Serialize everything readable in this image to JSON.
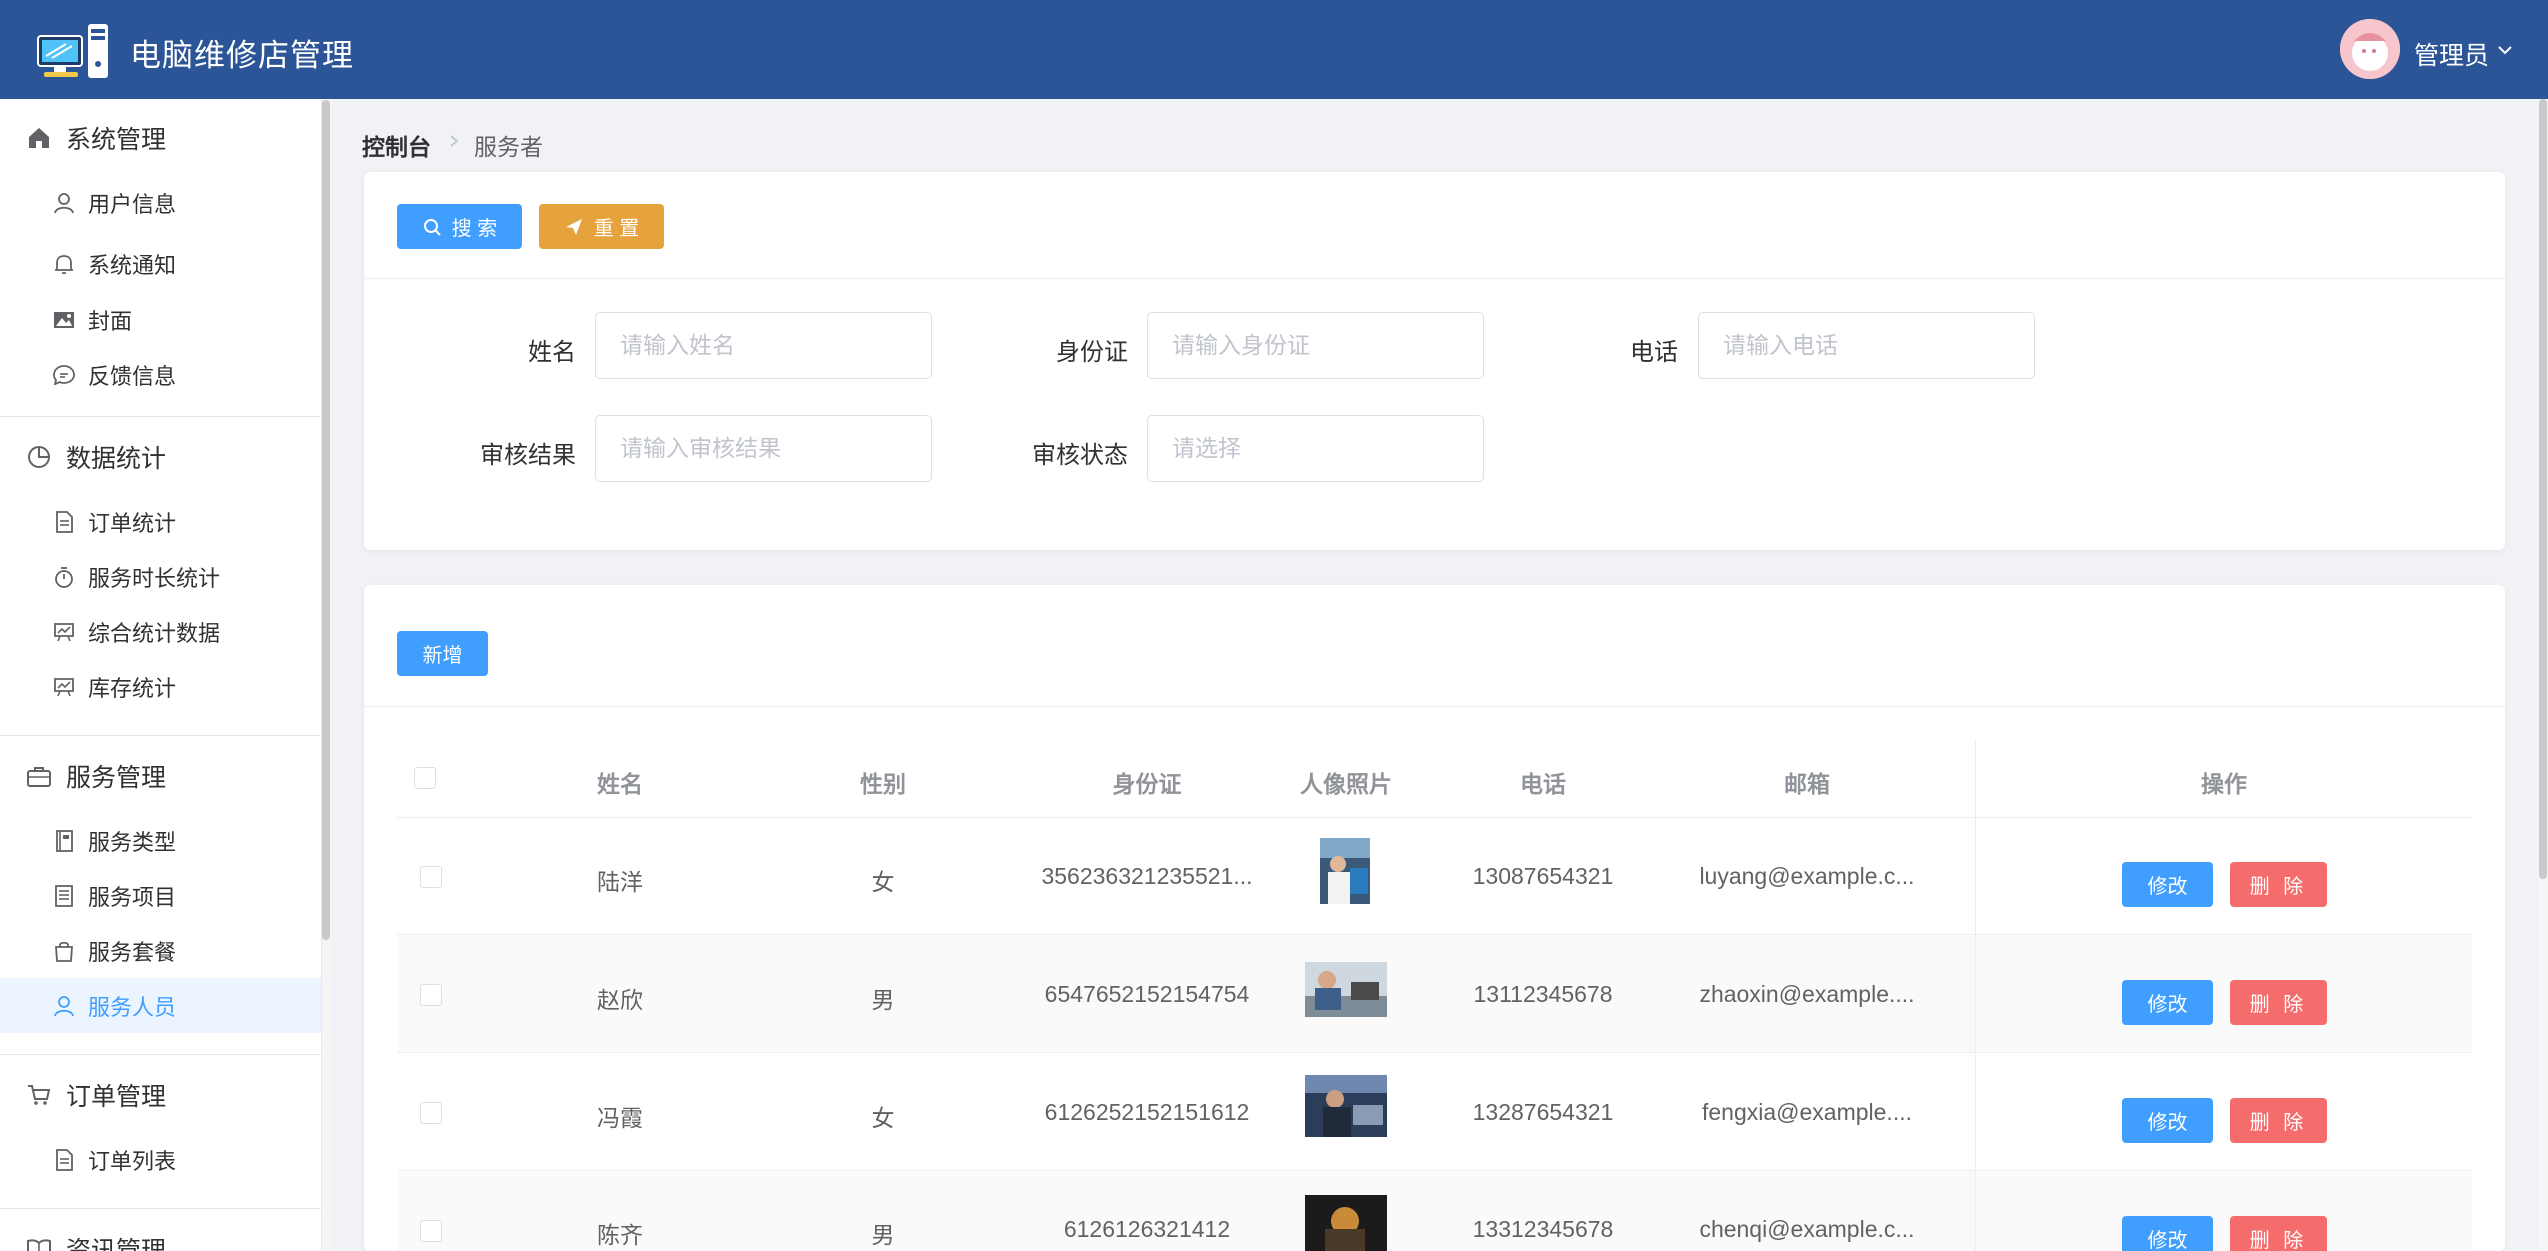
{
  "header": {
    "app_title": "电脑维修店管理",
    "user_name": "管理员",
    "bg_color": "#2b5597"
  },
  "sidebar": {
    "groups": [
      {
        "label": "系统管理",
        "icon": "home-icon",
        "items": [
          {
            "label": "用户信息",
            "icon": "user-icon"
          },
          {
            "label": "系统通知",
            "icon": "bell-icon"
          },
          {
            "label": "封面",
            "icon": "picture-icon"
          },
          {
            "label": "反馈信息",
            "icon": "chat-icon"
          }
        ]
      },
      {
        "label": "数据统计",
        "icon": "pie-chart-icon",
        "items": [
          {
            "label": "订单统计",
            "icon": "document-icon"
          },
          {
            "label": "服务时长统计",
            "icon": "stopwatch-icon"
          },
          {
            "label": "综合统计数据",
            "icon": "data-board-icon"
          },
          {
            "label": "库存统计",
            "icon": "data-board-icon"
          }
        ]
      },
      {
        "label": "服务管理",
        "icon": "briefcase-icon",
        "items": [
          {
            "label": "服务类型",
            "icon": "notebook-icon"
          },
          {
            "label": "服务项目",
            "icon": "list-icon"
          },
          {
            "label": "服务套餐",
            "icon": "bag-icon"
          },
          {
            "label": "服务人员",
            "icon": "user-icon",
            "active": true
          }
        ]
      },
      {
        "label": "订单管理",
        "icon": "cart-icon",
        "items": [
          {
            "label": "订单列表",
            "icon": "document-icon"
          }
        ]
      },
      {
        "label": "资讯管理",
        "icon": "reading-icon",
        "items": []
      }
    ]
  },
  "breadcrumb": {
    "home": "控制台",
    "current": "服务者"
  },
  "toolbar": {
    "search_label": "搜 索",
    "reset_label": "重 置",
    "add_label": "新增"
  },
  "filters": {
    "name": {
      "label": "姓名",
      "placeholder": "请输入姓名"
    },
    "id_card": {
      "label": "身份证",
      "placeholder": "请输入身份证"
    },
    "phone": {
      "label": "电话",
      "placeholder": "请输入电话"
    },
    "review_result": {
      "label": "审核结果",
      "placeholder": "请输入审核结果"
    },
    "review_status": {
      "label": "审核状态",
      "placeholder": "请选择"
    }
  },
  "table": {
    "columns": {
      "name": "姓名",
      "gender": "性别",
      "id_card": "身份证",
      "photo": "人像照片",
      "phone": "电话",
      "email": "邮箱",
      "actions": "操作"
    },
    "edit_label": "修改",
    "delete_label": "删 除",
    "rows": [
      {
        "name": "陆洋",
        "gender": "女",
        "id_card": "356236321235521...",
        "phone": "13087654321",
        "email": "luyang@example.c..."
      },
      {
        "name": "赵欣",
        "gender": "男",
        "id_card": "6547652152154754",
        "phone": "13112345678",
        "email": "zhaoxin@example...."
      },
      {
        "name": "冯霞",
        "gender": "女",
        "id_card": "6126252152151612",
        "phone": "13287654321",
        "email": "fengxia@example...."
      },
      {
        "name": "陈齐",
        "gender": "男",
        "id_card": "6126126321412",
        "phone": "13312345678",
        "email": "chenqi@example.c..."
      }
    ]
  },
  "colors": {
    "primary": "#409eff",
    "warning": "#e6a23c",
    "danger": "#f56c6c"
  }
}
